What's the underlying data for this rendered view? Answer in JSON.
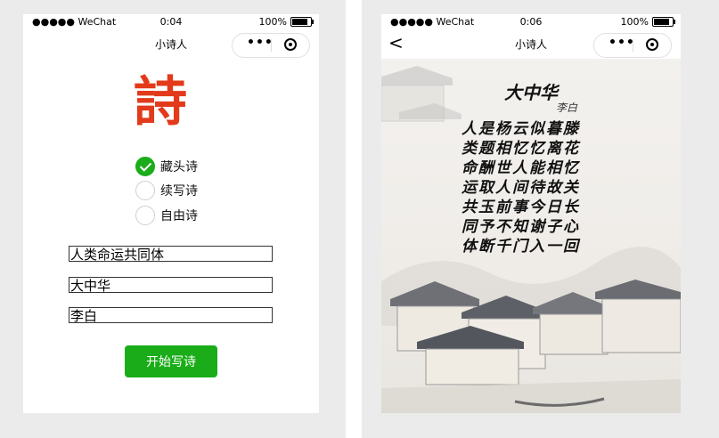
{
  "left": {
    "status": {
      "carrier": "●●●●● WeChat",
      "time": "0:04",
      "battery": "100%"
    },
    "nav_title": "小诗人",
    "logo_text": "詩",
    "modes": [
      {
        "label": "藏头诗",
        "checked": true
      },
      {
        "label": "续写诗",
        "checked": false
      },
      {
        "label": "自由诗",
        "checked": false
      }
    ],
    "inputs": {
      "theme": "人类命运共同体",
      "title": "大中华",
      "author": "李白"
    },
    "start_button": "开始写诗"
  },
  "right": {
    "status": {
      "carrier": "●●●●● WeChat",
      "time": "0:06",
      "battery": "100%"
    },
    "nav_title": "小诗人",
    "back": "<",
    "poem": {
      "title": "大中华",
      "author": "李白",
      "lines": [
        "人是杨云似暮滕",
        "类题相忆忆离花",
        "命酬世人能相忆",
        "运取人间待故关",
        "共玉前事今日长",
        "同予不知谢子心",
        "体断千门入一回"
      ]
    }
  },
  "colors": {
    "accent_green": "#1aad19",
    "logo_red": "#e23a1b"
  }
}
